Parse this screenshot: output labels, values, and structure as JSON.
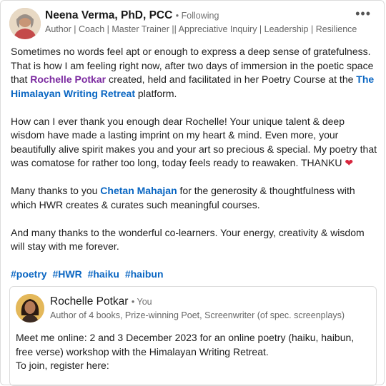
{
  "post": {
    "author_name": "Neena Verma, PhD, PCC",
    "follow_status": "• Following",
    "headline": "Author | Coach | Master Trainer || Appreciative Inquiry | Leadership | Resilience | Wel...",
    "more_icon": "•••",
    "p1_a": "Sometimes no words feel apt or enough to express a deep sense of gratefulness. That is how I am feeling right now, after two days of immersion in the poetic space that ",
    "p1_mention1": "Rochelle Potkar",
    "p1_b": " created, held and facilitated in her Poetry Course at the ",
    "p1_mention2": "The Himalayan Writing Retreat",
    "p1_c": " platform.",
    "p2": "How can I ever thank you enough dear Rochelle! Your unique talent & deep wisdom have made a lasting imprint on my heart & mind. Even more, your beautifully alive spirit makes you and your art so precious & special. My poetry that was comatose for rather too long, today feels ready to reawaken. THANKU ",
    "heart": "❤",
    "p3_a": "Many thanks to you ",
    "p3_mention": "Chetan Mahajan",
    "p3_b": " for the generosity & thoughtfulness with which HWR creates & curates such meaningful courses.",
    "p4": "And many thanks to the wonderful co-learners. Your energy, creativity & wisdom will stay with me forever.",
    "hashtags": [
      "#poetry",
      "#HWR",
      "#haiku",
      "#haibun"
    ]
  },
  "repost": {
    "author_name": "Rochelle Potkar",
    "you_label": "• You",
    "headline": "Author of 4 books, Prize-winning Poet, Screenwriter (of spec. screenplays)",
    "text_1": "Meet me online: 2 and 3 December 2023 for an online poetry (haiku, haibun, free verse) workshop with the Himalayan Writing Retreat.",
    "text_2": "To join, register here:"
  },
  "colors": {
    "link": "#0a66c2",
    "mention_purple": "#7b2aa0",
    "heart": "#d7263d"
  }
}
